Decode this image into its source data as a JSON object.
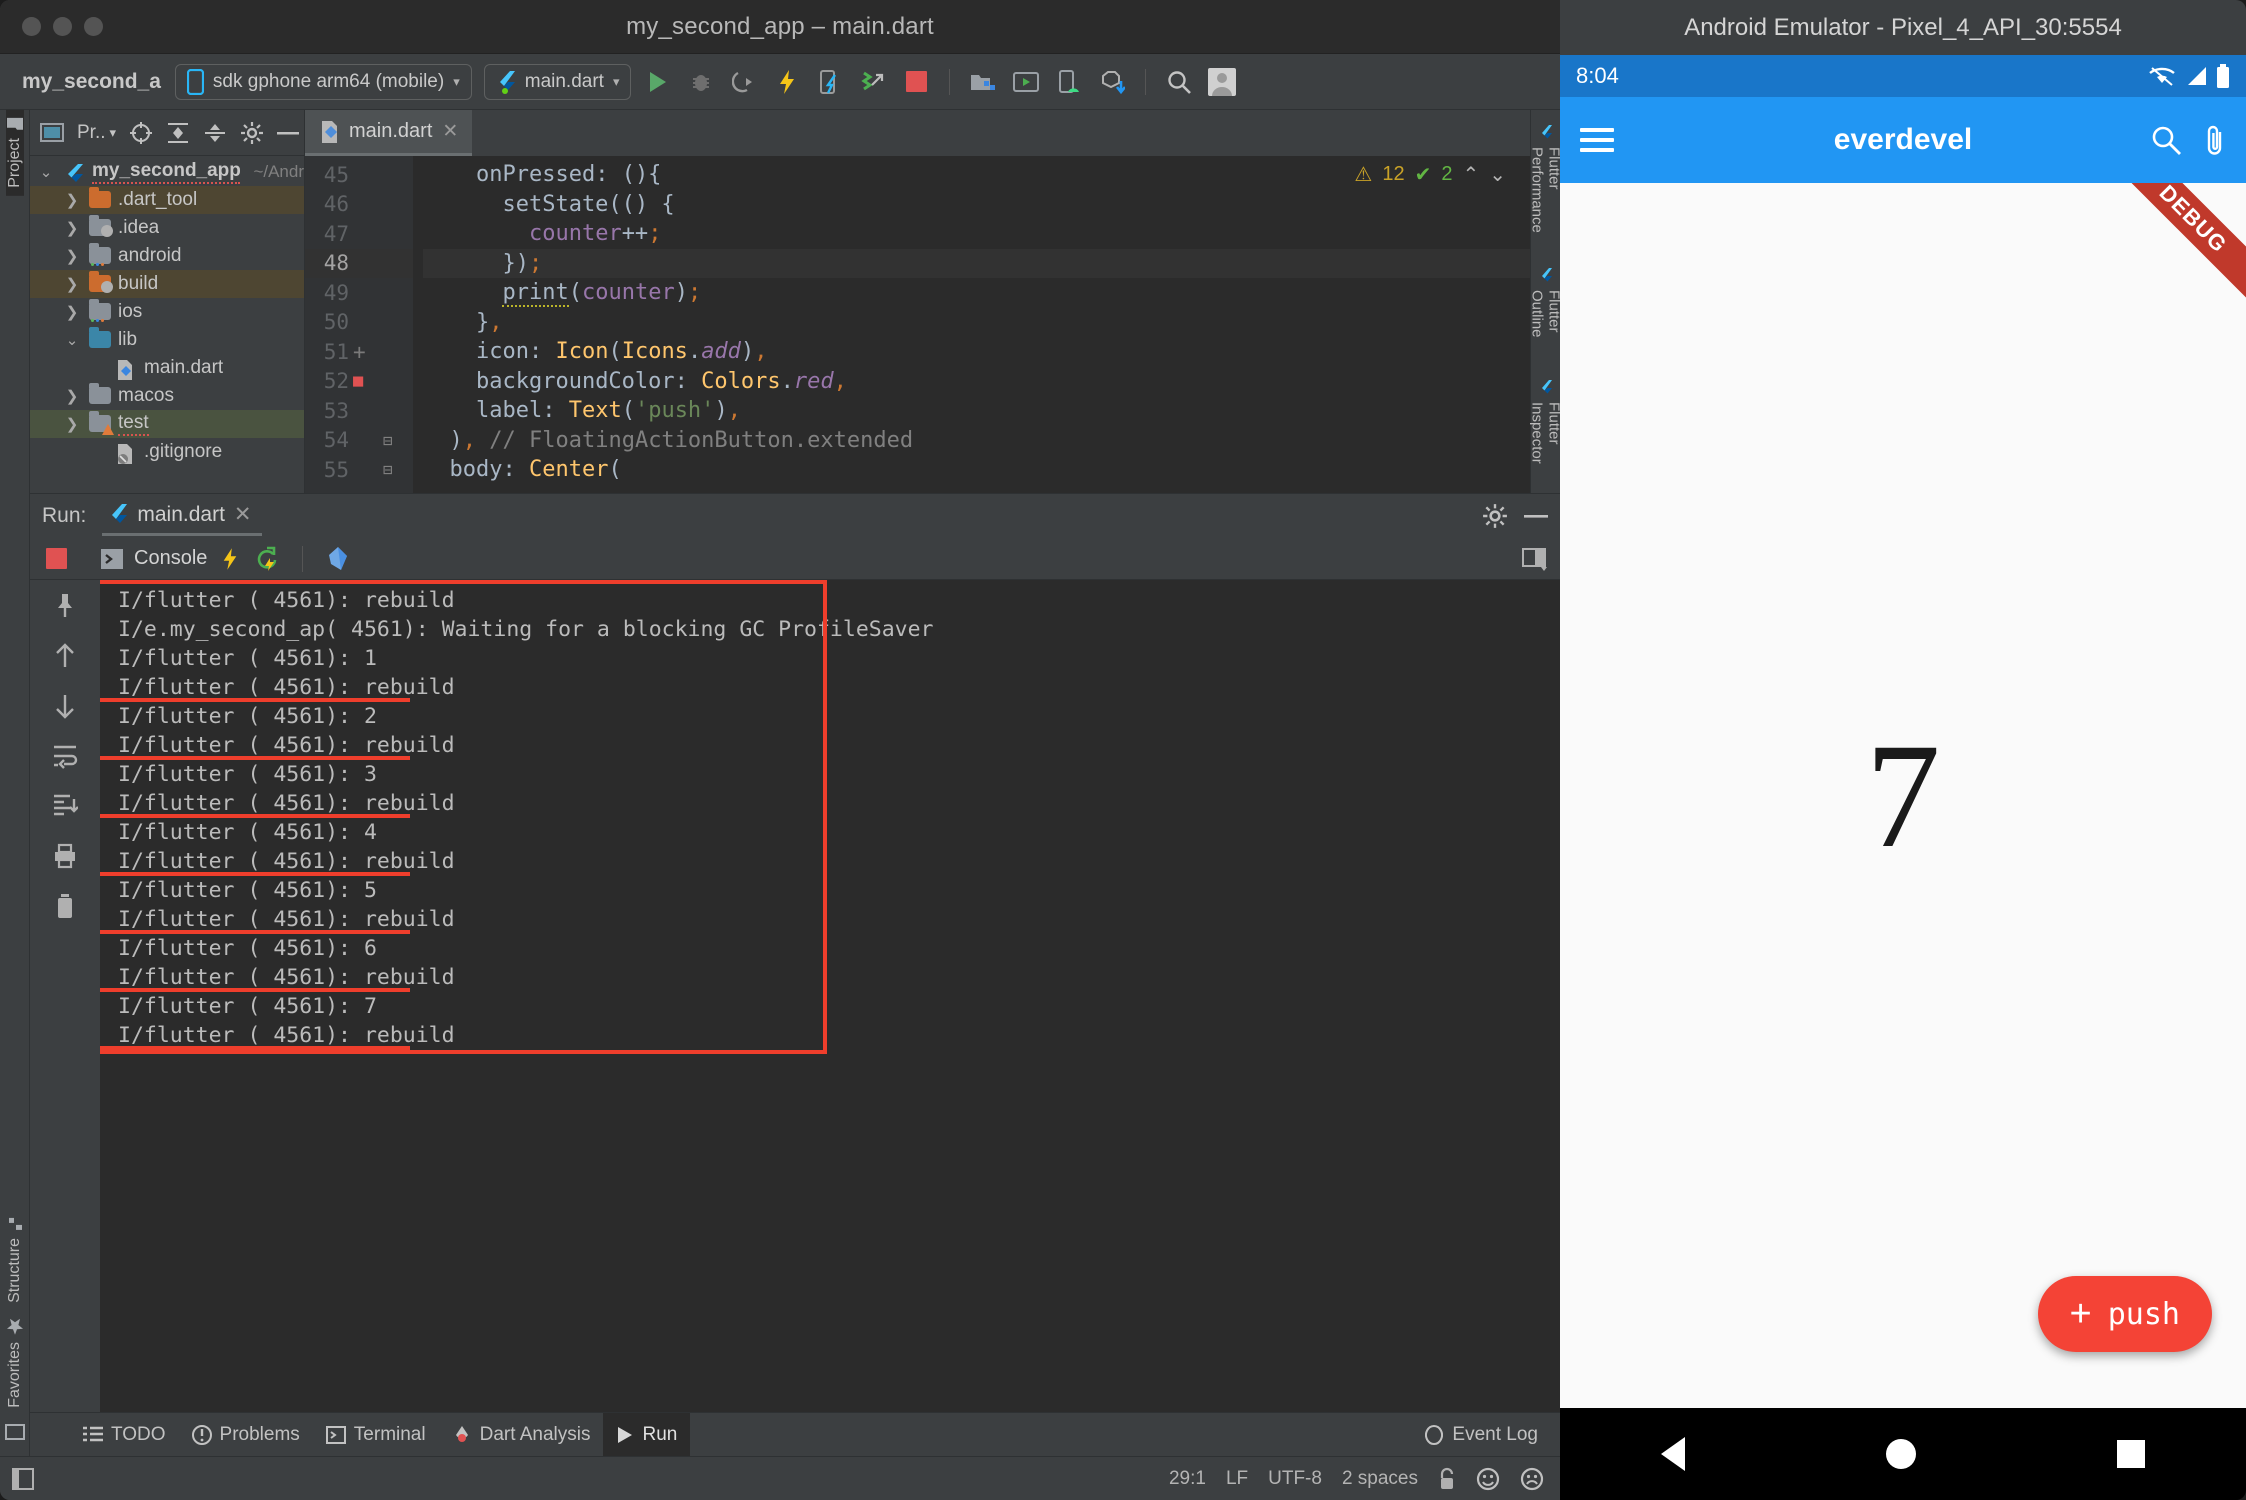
{
  "window": {
    "title": "my_second_app – main.dart"
  },
  "toolbar": {
    "project_name": "my_second_a",
    "device_selector": "sdk gphone arm64 (mobile)",
    "run_config": "main.dart",
    "caret": "▾",
    "icons": [
      "run-icon",
      "debug-icon",
      "run-coverage-icon",
      "hot-reload-icon",
      "open-devtools-icon",
      "profile-icon",
      "stop-icon",
      "project-structure-icon",
      "avd-manager-icon",
      "sdk-device-icon",
      "sdk-download-icon",
      "search-icon",
      "account-avatar-icon"
    ]
  },
  "left_strip": {
    "project_tab": "Project",
    "structure_tab": "Structure",
    "favorites_tab": "Favorites"
  },
  "project_panel": {
    "header_label": "Pr..",
    "header_icons": [
      "project-view-icon",
      "locate-icon",
      "expand-all-icon",
      "collapse-all-icon",
      "settings-icon",
      "hide-icon"
    ],
    "tree": [
      {
        "label": "my_second_app",
        "sub": "~/Andr",
        "indent": 0,
        "arrow": "v",
        "icon": "flutter",
        "bold": true,
        "highlight": "none",
        "squiggle": true
      },
      {
        "label": ".dart_tool",
        "sub": "",
        "indent": 1,
        "arrow": ">",
        "icon": "folder-orange",
        "bold": false,
        "highlight": "brown",
        "squiggle": false
      },
      {
        "label": ".idea",
        "sub": "",
        "indent": 1,
        "arrow": ">",
        "icon": "folder-gray-fan",
        "bold": false,
        "highlight": "none",
        "squiggle": false
      },
      {
        "label": "android",
        "sub": "",
        "indent": 1,
        "arrow": ">",
        "icon": "folder-gray-dots",
        "bold": false,
        "highlight": "none",
        "squiggle": false
      },
      {
        "label": "build",
        "sub": "",
        "indent": 1,
        "arrow": ">",
        "icon": "folder-orange-fan",
        "bold": false,
        "highlight": "brown",
        "squiggle": false
      },
      {
        "label": "ios",
        "sub": "",
        "indent": 1,
        "arrow": ">",
        "icon": "folder-gray-dots",
        "bold": false,
        "highlight": "none",
        "squiggle": false
      },
      {
        "label": "lib",
        "sub": "",
        "indent": 1,
        "arrow": "v",
        "icon": "folder-blue",
        "bold": false,
        "highlight": "none",
        "squiggle": false
      },
      {
        "label": "main.dart",
        "sub": "",
        "indent": 2,
        "arrow": "",
        "icon": "dart-file",
        "bold": false,
        "highlight": "none",
        "squiggle": false
      },
      {
        "label": "macos",
        "sub": "",
        "indent": 1,
        "arrow": ">",
        "icon": "folder-gray",
        "bold": false,
        "highlight": "none",
        "squiggle": false
      },
      {
        "label": "test",
        "sub": "",
        "indent": 1,
        "arrow": ">",
        "icon": "folder-gray-test",
        "bold": false,
        "highlight": "green",
        "squiggle": true
      },
      {
        "label": ".gitignore",
        "sub": "",
        "indent": 2,
        "arrow": "",
        "icon": "gitignore-file",
        "bold": false,
        "highlight": "none",
        "squiggle": false
      }
    ]
  },
  "editor": {
    "tab_label": "main.dart",
    "tab_close": "✕",
    "inspections": {
      "warnings": "12",
      "ok": "2",
      "up": "⌃",
      "down": "⌄"
    },
    "current_line": 48,
    "lines": [
      {
        "num": "45",
        "marker": "",
        "fold": "",
        "text": "    onPressed: (){"
      },
      {
        "num": "46",
        "marker": "",
        "fold": "",
        "text": "      setState(() {"
      },
      {
        "num": "47",
        "marker": "",
        "fold": "",
        "text": "        counter++;"
      },
      {
        "num": "48",
        "marker": "",
        "fold": "",
        "text": "      });"
      },
      {
        "num": "49",
        "marker": "",
        "fold": "",
        "text": "      print(counter);"
      },
      {
        "num": "50",
        "marker": "",
        "fold": "",
        "text": "    },"
      },
      {
        "num": "51",
        "marker": "+",
        "fold": "",
        "text": "    icon: Icon(Icons.add),"
      },
      {
        "num": "52",
        "marker": "■",
        "fold": "",
        "text": "    backgroundColor: Colors.red,"
      },
      {
        "num": "53",
        "marker": "",
        "fold": "",
        "text": "    label: Text('push'),"
      },
      {
        "num": "54",
        "marker": "",
        "fold": "−",
        "text": "  ), // FloatingActionButton.extended"
      },
      {
        "num": "55",
        "marker": "",
        "fold": "−",
        "text": "  body: Center("
      }
    ]
  },
  "right_strip": {
    "items": [
      "Flutter Performance",
      "Flutter Outline",
      "Flutter Inspector"
    ]
  },
  "run_window": {
    "label": "Run:",
    "tab": "main.dart",
    "tab_close": "✕",
    "console_chip": "Console",
    "toolbar_icons": [
      "rerun-icon",
      "stop-icon",
      "console-icon",
      "hot-reload-icon",
      "restart-icon",
      "dart-devtools-icon",
      "layout-icon"
    ],
    "side_icons": [
      "pin-icon",
      "up-icon",
      "down-icon",
      "soft-wrap-icon",
      "scroll-end-icon",
      "print-icon",
      "trash-icon"
    ],
    "console_lines": [
      "I/flutter ( 4561): rebuild",
      "I/e.my_second_ap( 4561): Waiting for a blocking GC ProfileSaver",
      "I/flutter ( 4561): 1",
      "I/flutter ( 4561): rebuild",
      "I/flutter ( 4561): 2",
      "I/flutter ( 4561): rebuild",
      "I/flutter ( 4561): 3",
      "I/flutter ( 4561): rebuild",
      "I/flutter ( 4561): 4",
      "I/flutter ( 4561): rebuild",
      "I/flutter ( 4561): 5",
      "I/flutter ( 4561): rebuild",
      "I/flutter ( 4561): 6",
      "I/flutter ( 4561): rebuild",
      "I/flutter ( 4561): 7",
      "I/flutter ( 4561): rebuild"
    ],
    "annotation_color": "#ef3e2c"
  },
  "bottom_nav": {
    "items": [
      {
        "label": "TODO",
        "icon": "todo-icon",
        "active": false
      },
      {
        "label": "Problems",
        "icon": "problems-icon",
        "active": false
      },
      {
        "label": "Terminal",
        "icon": "terminal-icon",
        "active": false
      },
      {
        "label": "Dart Analysis",
        "icon": "dart-analysis-icon",
        "active": false
      },
      {
        "label": "Run",
        "icon": "run-icon",
        "active": true
      }
    ],
    "event_log": "Event Log"
  },
  "status_bar": {
    "caret": "29:1",
    "line_sep": "LF",
    "encoding": "UTF-8",
    "indent": "2 spaces",
    "icons": [
      "lock-icon",
      "happy-face-icon",
      "sad-face-icon"
    ]
  },
  "emulator": {
    "title": "Android Emulator - Pixel_4_API_30:5554",
    "clock": "8:04",
    "status_icons": [
      "wifi-off-icon",
      "signal-icon",
      "battery-icon"
    ],
    "app_title": "everdevel",
    "appbar_icons": [
      "menu-icon",
      "search-icon",
      "attach-icon"
    ],
    "debug_ribbon": "DEBUG",
    "counter_value": "7",
    "fab_label": "push",
    "fab_plus": "+",
    "fab_color": "#f44336",
    "appbar_color": "#2196f3",
    "nav_buttons": [
      "back-button",
      "home-button",
      "recents-button"
    ]
  }
}
